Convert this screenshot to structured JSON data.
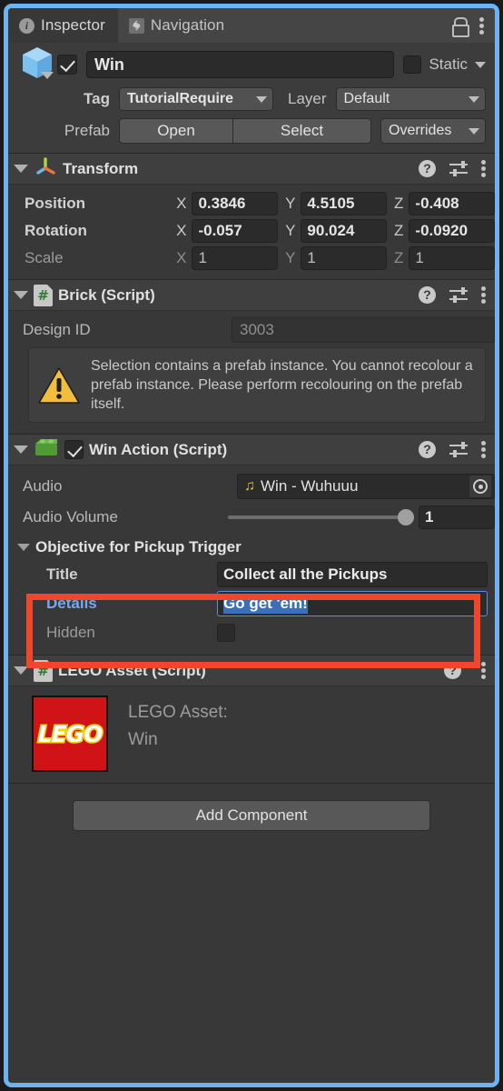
{
  "window": {
    "tabs": [
      {
        "label": "Inspector",
        "icon": "info-icon",
        "active": true
      },
      {
        "label": "Navigation",
        "icon": "navigation-icon",
        "active": false
      }
    ],
    "lock_icon": "lock-icon",
    "menu_icon": "kebab-menu-icon"
  },
  "gameobject": {
    "icon": "prefab-cube-icon",
    "enabled": true,
    "name": "Win",
    "static_label": "Static",
    "static_checked": false,
    "tag_label": "Tag",
    "tag_value": "TutorialRequire",
    "layer_label": "Layer",
    "layer_value": "Default",
    "prefab_label": "Prefab",
    "open_button": "Open",
    "select_button": "Select",
    "overrides_button": "Overrides"
  },
  "transform": {
    "title": "Transform",
    "icon": "transform-gizmo-icon",
    "rows": [
      {
        "label": "Position",
        "x": "0.3846",
        "y": "4.5105",
        "z": "-0.408",
        "dim": false
      },
      {
        "label": "Rotation",
        "x": "-0.057",
        "y": "90.024",
        "z": "-0.0920",
        "dim": false
      },
      {
        "label": "Scale",
        "x": "1",
        "y": "1",
        "z": "1",
        "dim": true
      }
    ],
    "axes": {
      "x": "X",
      "y": "Y",
      "z": "Z"
    }
  },
  "brick": {
    "title": "Brick (Script)",
    "icon": "csharp-script-icon",
    "design_id_label": "Design ID",
    "design_id_value": "3003",
    "warning_icon": "warning-triangle-icon",
    "warning_text": "Selection contains a prefab instance. You cannot recolour a prefab instance. Please perform recolouring on the prefab itself."
  },
  "win_action": {
    "title": "Win Action (Script)",
    "icon": "lego-brick-icon",
    "enabled": true,
    "audio_label": "Audio",
    "audio_value": "Win - Wuhuuu",
    "audio_icon": "music-note-icon",
    "picker_icon": "object-picker-icon",
    "audio_volume_label": "Audio Volume",
    "audio_volume_value": "1",
    "objective_section_title": "Objective for Pickup Trigger",
    "title_label": "Title",
    "title_value": "Collect all the Pickups",
    "details_label": "Details",
    "details_value": "Go get 'em!",
    "details_focused": true,
    "hidden_label": "Hidden",
    "hidden_checked": false
  },
  "lego_asset": {
    "title": "LEGO Asset (Script)",
    "icon": "csharp-script-icon",
    "logo_text": "LEGO",
    "caption_line1": "LEGO Asset:",
    "caption_line2": "Win"
  },
  "footer": {
    "add_component_label": "Add Component"
  },
  "colors": {
    "panel_highlight": "#6db3f2",
    "red_highlight": "#f0462a",
    "background": "#383838",
    "header": "#3f3f3f",
    "selection_blue": "#3b6fb8",
    "lego_red": "#d01317",
    "lego_yellow": "#f5d800",
    "warning_yellow": "#f2bc3c"
  }
}
